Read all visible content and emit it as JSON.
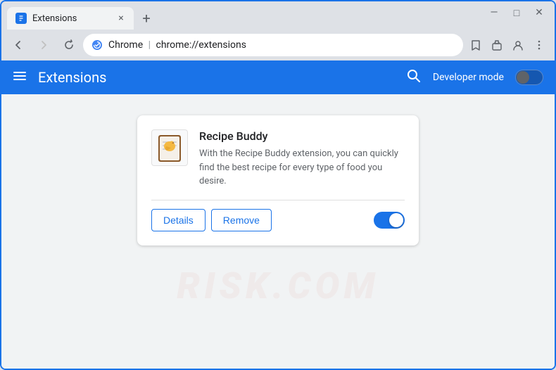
{
  "browser": {
    "tab": {
      "favicon": "★",
      "title": "Extensions",
      "close": "×"
    },
    "newTab": "+",
    "windowControls": {
      "minimize": "—",
      "maximize": "□",
      "close": "✕"
    },
    "addressBar": {
      "back": "←",
      "forward": "→",
      "reload": "↻",
      "secure": "🌐",
      "siteName": "Chrome",
      "separator": "|",
      "url": "chrome://extensions",
      "favorite": "☆",
      "extensions": "🧩",
      "account": "👤",
      "menu": "⋮"
    }
  },
  "header": {
    "menu": "≡",
    "title": "Extensions",
    "search_label": "search",
    "devMode": "Developer mode",
    "toggleOn": false
  },
  "extension": {
    "name": "Recipe Buddy",
    "description": "With the Recipe Buddy extension, you can quickly find the best recipe for every type of food you desire.",
    "detailsBtn": "Details",
    "removeBtn": "Remove",
    "enabled": true
  },
  "watermark": {
    "text": "RISK.COM"
  },
  "colors": {
    "brand": "#1a73e8",
    "headerBg": "#1a73e8",
    "browserFrame": "#dee1e6",
    "tabBg": "#f1f3f4",
    "contentBg": "#f1f3f4"
  }
}
